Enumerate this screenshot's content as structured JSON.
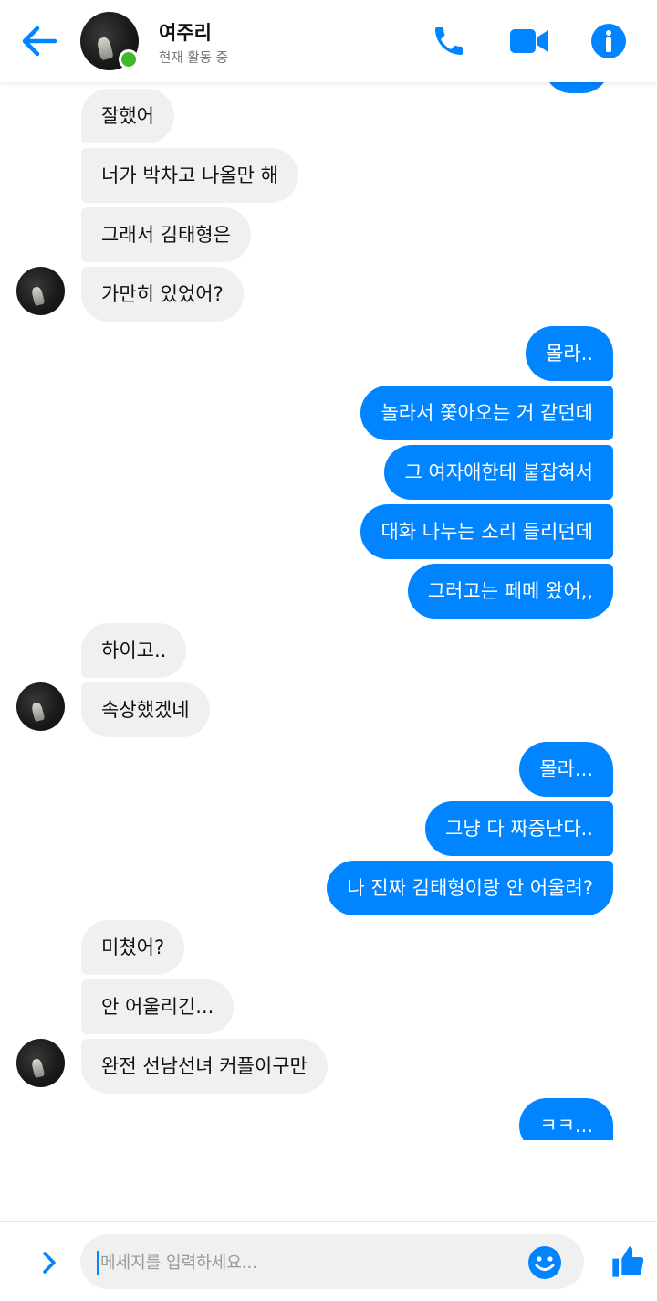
{
  "header": {
    "contact_name": "여주리",
    "status": "현재 활동 중",
    "icons": {
      "back": "back-arrow-icon",
      "call": "phone-icon",
      "video": "video-camera-icon",
      "info": "info-icon"
    }
  },
  "theme": {
    "accent": "#0084ff",
    "received_bubble": "#f1f0f0",
    "online": "#42b72a"
  },
  "messages": [
    {
      "sender": "them",
      "text": "잘했어"
    },
    {
      "sender": "them",
      "text": "너가 박차고 나올만 해"
    },
    {
      "sender": "them",
      "text": "그래서 김태형은"
    },
    {
      "sender": "them",
      "text": "가만히 있었어?"
    },
    {
      "sender": "me",
      "text": "몰라.."
    },
    {
      "sender": "me",
      "text": "놀라서 쫓아오는 거 같던데"
    },
    {
      "sender": "me",
      "text": "그 여자애한테 붙잡혀서"
    },
    {
      "sender": "me",
      "text": "대화 나누는 소리 들리던데"
    },
    {
      "sender": "me",
      "text": "그러고는 페메 왔어,,"
    },
    {
      "sender": "them",
      "text": "하이고.."
    },
    {
      "sender": "them",
      "text": "속상했겠네"
    },
    {
      "sender": "me",
      "text": "몰라..."
    },
    {
      "sender": "me",
      "text": "그냥 다 짜증난다.."
    },
    {
      "sender": "me",
      "text": "나 진짜 김태형이랑 안 어울려?"
    },
    {
      "sender": "them",
      "text": "미쳤어?"
    },
    {
      "sender": "them",
      "text": "안 어울리긴..."
    },
    {
      "sender": "them",
      "text": "완전 선남선녀 커플이구만"
    },
    {
      "sender": "me",
      "text": "ㅋㅋ..."
    }
  ],
  "composer": {
    "placeholder": "메세지를 입력하세요...",
    "icons": {
      "expand": "chevron-right-icon",
      "emoji": "smiley-icon",
      "like": "thumbs-up-icon"
    }
  }
}
